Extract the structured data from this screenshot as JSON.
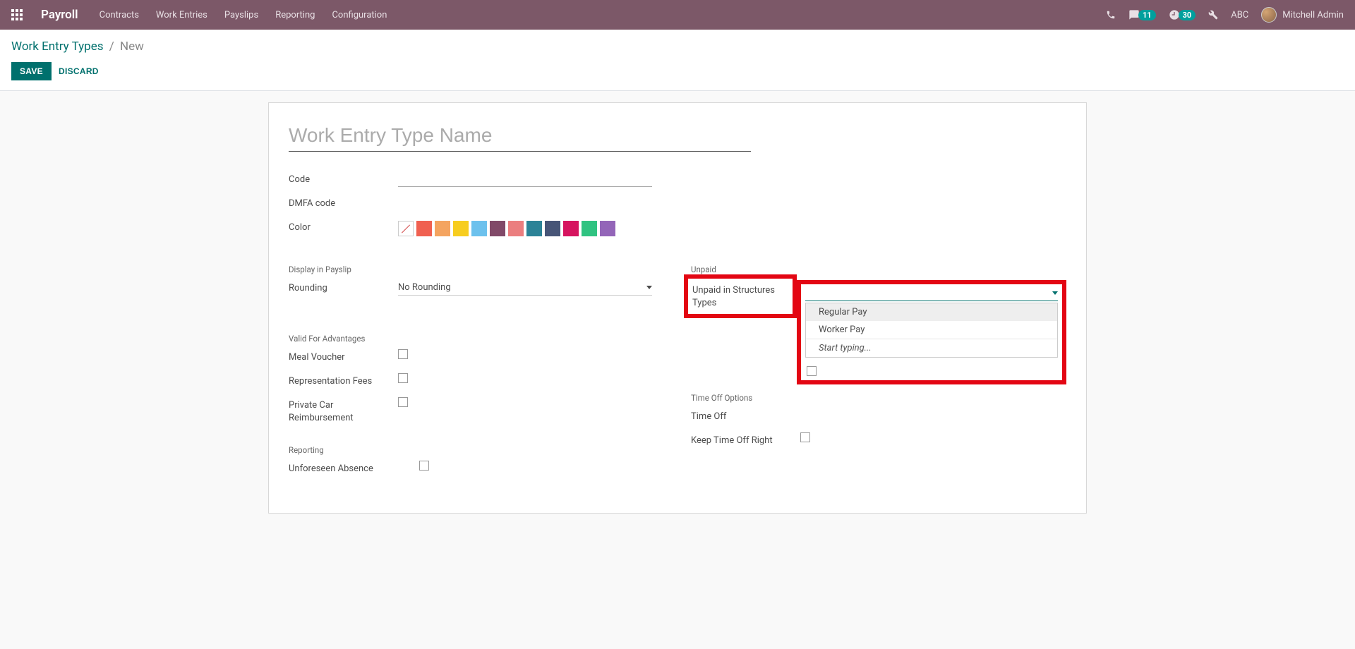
{
  "navbar": {
    "brand": "Payroll",
    "menu": [
      "Contracts",
      "Work Entries",
      "Payslips",
      "Reporting",
      "Configuration"
    ],
    "msg_badge": "11",
    "clock_badge": "30",
    "company": "ABC",
    "user": "Mitchell Admin"
  },
  "breadcrumb": {
    "parent": "Work Entry Types",
    "current": "New"
  },
  "buttons": {
    "save": "SAVE",
    "discard": "DISCARD"
  },
  "form": {
    "title_placeholder": "Work Entry Type Name",
    "labels": {
      "code": "Code",
      "dmfa": "DMFA code",
      "color": "Color",
      "display_section": "Display in Payslip",
      "rounding": "Rounding",
      "rounding_value": "No Rounding",
      "unpaid_section": "Unpaid",
      "unpaid_structures": "Unpaid in Structures Types",
      "advantages_section": "Valid For Advantages",
      "meal_voucher": "Meal Voucher",
      "rep_fees": "Representation Fees",
      "private_car": "Private Car Reimbursement",
      "timeoff_section": "Time Off Options",
      "timeoff": "Time Off",
      "keep_timeoff": "Keep Time Off Right",
      "reporting_section": "Reporting",
      "unforeseen": "Unforeseen Absence"
    },
    "dropdown_options": {
      "opt1": "Regular Pay",
      "opt2": "Worker Pay",
      "start_typing": "Start typing..."
    },
    "colors": [
      "#F06050",
      "#F4A460",
      "#F7CD1F",
      "#6CC1ED",
      "#814968",
      "#EB7E7F",
      "#2C8397",
      "#475577",
      "#D6145F",
      "#30C381",
      "#9365B8"
    ]
  }
}
